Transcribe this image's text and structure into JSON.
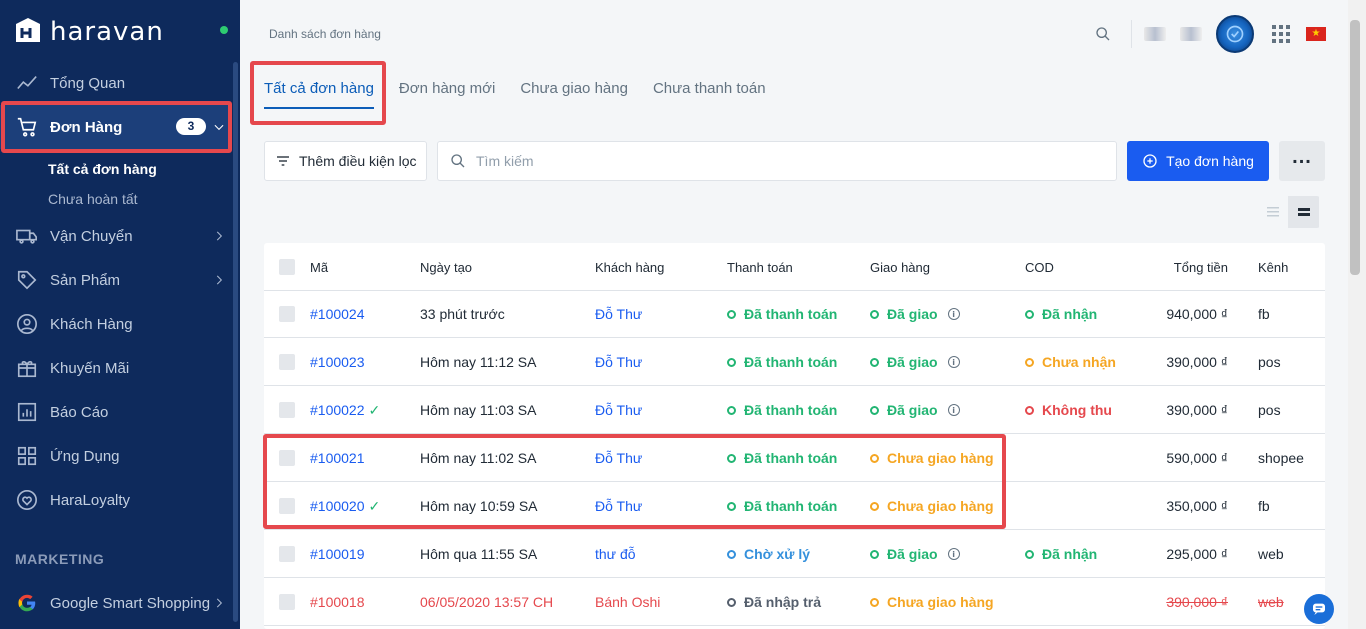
{
  "brand": {
    "name": "haravan"
  },
  "sidebar": {
    "items": [
      {
        "label": "Tổng Quan",
        "icon": "trend-icon"
      },
      {
        "label": "Đơn Hàng",
        "icon": "cart-icon",
        "badge": "3"
      },
      {
        "label": "Vận Chuyển",
        "icon": "truck-icon"
      },
      {
        "label": "Sản Phẩm",
        "icon": "tag-icon"
      },
      {
        "label": "Khách Hàng",
        "icon": "user-circle-icon"
      },
      {
        "label": "Khuyến Mãi",
        "icon": "gift-icon"
      },
      {
        "label": "Báo Cáo",
        "icon": "report-icon"
      },
      {
        "label": "Ứng Dụng",
        "icon": "apps-icon"
      },
      {
        "label": "HaraLoyalty",
        "icon": "heart-icon"
      },
      {
        "label": "Google Smart Shopping",
        "icon": "google-icon"
      }
    ],
    "sub_items": [
      "Tất cả đơn hàng",
      "Chưa hoàn tất"
    ],
    "section_marketing": "MARKETING"
  },
  "header": {
    "breadcrumb": "Danh sách đơn hàng"
  },
  "tabs": [
    "Tất cả đơn hàng",
    "Đơn hàng mới",
    "Chưa giao hàng",
    "Chưa thanh toán"
  ],
  "filter": {
    "label": "Thêm điều kiện lọc",
    "search_placeholder": "Tìm kiếm"
  },
  "actions": {
    "create_label": "Tạo đơn hàng"
  },
  "table": {
    "headers": [
      "Mã",
      "Ngày tạo",
      "Khách hàng",
      "Thanh toán",
      "Giao hàng",
      "COD",
      "Tổng tiền",
      "Kênh"
    ],
    "rows": [
      {
        "id": "#100024",
        "date": "33 phút trước",
        "customer": "Đỗ Thư",
        "payment": "Đã thanh toán",
        "shipping": "Đã giao",
        "cod": "Đã nhận",
        "total": "940,000 ₫",
        "channel": "fb"
      },
      {
        "id": "#100023",
        "date": "Hôm nay 11:12 SA",
        "customer": "Đỗ Thư",
        "payment": "Đã thanh toán",
        "shipping": "Đã giao",
        "cod": "Chưa nhận",
        "total": "390,000 ₫",
        "channel": "pos"
      },
      {
        "id": "#100022",
        "date": "Hôm nay 11:03 SA",
        "customer": "Đỗ Thư",
        "payment": "Đã thanh toán",
        "shipping": "Đã giao",
        "cod": "Không thu",
        "total": "390,000 ₫",
        "channel": "pos"
      },
      {
        "id": "#100021",
        "date": "Hôm nay 11:02 SA",
        "customer": "Đỗ Thư",
        "payment": "Đã thanh toán",
        "shipping": "Chưa giao hàng",
        "cod": "",
        "total": "590,000 ₫",
        "channel": "shopee"
      },
      {
        "id": "#100020",
        "date": "Hôm nay 10:59 SA",
        "customer": "Đỗ Thư",
        "payment": "Đã thanh toán",
        "shipping": "Chưa giao hàng",
        "cod": "",
        "total": "350,000 ₫",
        "channel": "fb"
      },
      {
        "id": "#100019",
        "date": "Hôm qua 11:55 SA",
        "customer": "thư đỗ",
        "payment": "Chờ xử lý",
        "shipping": "Đã giao",
        "cod": "Đã nhận",
        "total": "295,000 ₫",
        "channel": "web"
      },
      {
        "id": "#100018",
        "date": "06/05/2020 13:57 CH",
        "customer": "Bánh Oshi",
        "payment": "Đã nhập trả",
        "shipping": "Chưa giao hàng",
        "cod": "",
        "total": "390,000 ₫",
        "channel": "web"
      }
    ]
  },
  "colors": {
    "sidebar_bg": "#0e2a5c",
    "primary": "#1a5cf0",
    "success": "#22b573",
    "warning": "#f5a623",
    "danger": "#e5484d",
    "highlight": "#e5484d"
  }
}
